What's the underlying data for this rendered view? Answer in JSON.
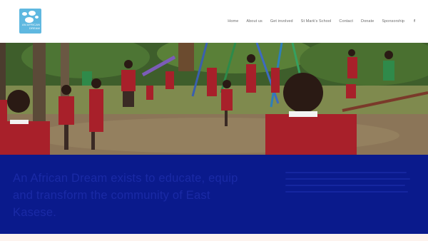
{
  "logo": {
    "text": "An African Dream",
    "brand_color": "#5fb8e0"
  },
  "nav": {
    "items": [
      {
        "label": "Home"
      },
      {
        "label": "About us"
      },
      {
        "label": "Get involved"
      },
      {
        "label": "St Mark's School"
      },
      {
        "label": "Contact"
      },
      {
        "label": "Donate"
      },
      {
        "label": "Sponsorship"
      }
    ],
    "social_icon": "facebook-icon",
    "social_glyph": "f"
  },
  "hero": {
    "image": "schoolchildren in red uniforms playing at a playground"
  },
  "banner": {
    "mission": "An African Dream exists to educate, equip and transform the community of East Kasese.",
    "background": "#0a1a8c"
  }
}
